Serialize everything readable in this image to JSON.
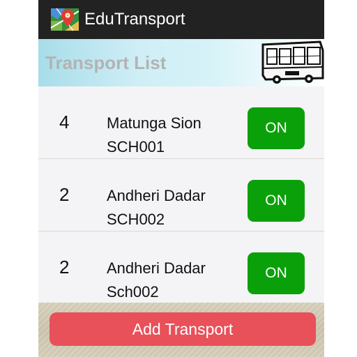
{
  "app": {
    "title": "EduTransport"
  },
  "header": {
    "title": "Transport List"
  },
  "transports": [
    {
      "count": "4",
      "route": "Matunga Sion",
      "code": "SCH001",
      "status_label": "ON"
    },
    {
      "count": "2",
      "route": "Andheri Dadar",
      "code": "SCH002",
      "status_label": "ON"
    },
    {
      "count": "2",
      "route": "Andheri Dadar",
      "code": "Sch002",
      "status_label": "ON"
    }
  ],
  "footer": {
    "add_label": "Add Transport"
  },
  "colors": {
    "action_bar": "#222222",
    "on_button": "#0aa00a",
    "add_button": "#e8505a"
  },
  "icons": {
    "app": "map-pin-app-icon",
    "header": "bus-icon"
  }
}
